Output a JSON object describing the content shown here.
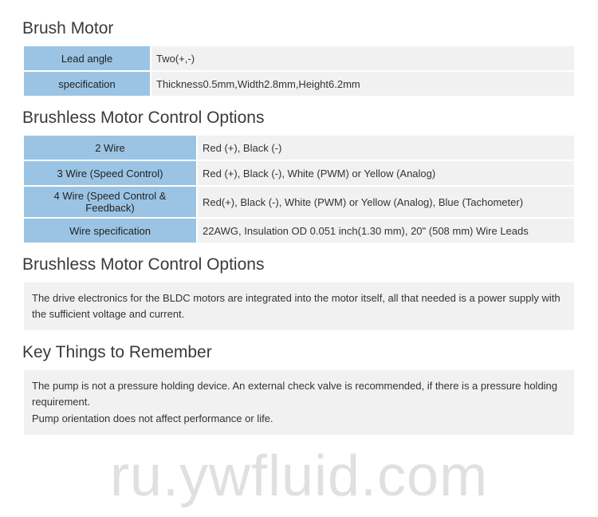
{
  "section1": {
    "title": "Brush Motor",
    "rows": [
      {
        "label": "Lead angle",
        "value": "Two(+,-)"
      },
      {
        "label": "specification",
        "value": "Thickness0.5mm,Width2.8mm,Height6.2mm"
      }
    ]
  },
  "section2": {
    "title": "Brushless Motor Control Options",
    "rows": [
      {
        "label": "2 Wire",
        "value": "Red (+), Black (-)"
      },
      {
        "label": "3 Wire (Speed Control)",
        "value": "Red (+), Black (-), White (PWM) or Yellow (Analog)"
      },
      {
        "label": "4 Wire (Speed Control & Feedback)",
        "value": "Red(+), Black (-), White (PWM) or Yellow (Analog), Blue (Tachometer)"
      },
      {
        "label": "Wire specification",
        "value": "22AWG, Insulation OD 0.051 inch(1.30 mm), 20\" (508 mm) Wire Leads"
      }
    ]
  },
  "section3": {
    "title": "Brushless Motor Control Options",
    "text": "The drive electronics for the BLDC motors are integrated into the motor itself, all that needed is a power supply with the sufficient voltage and current."
  },
  "section4": {
    "title": "Key Things to Remember",
    "line1": "The pump is not a pressure holding device. An external check valve is recommended, if there is a pressure holding requirement.",
    "line2": "Pump orientation does not affect performance or life."
  },
  "watermark": "ru.ywfluid.com"
}
